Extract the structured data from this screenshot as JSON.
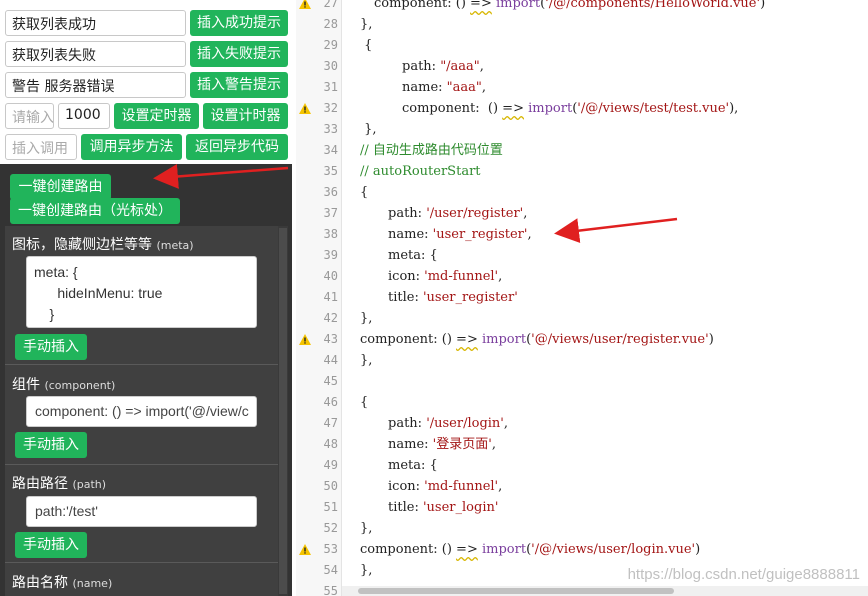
{
  "left": {
    "row1": {
      "input": "获取列表成功",
      "button": "插入成功提示"
    },
    "row2": {
      "input": "获取列表失败",
      "button": "插入失败提示"
    },
    "row3": {
      "input": "警告 服务器错误",
      "button": "插入警告提示"
    },
    "row4": {
      "input_placeholder": "请输入",
      "number_value": "1000",
      "btn_timer": "设置定时器",
      "btn_counter": "设置计时器"
    },
    "row5": {
      "input_placeholder": "插入调用",
      "btn_async_call": "调用异步方法",
      "btn_async_return": "返回异步代码"
    },
    "route": {
      "btn_create": "一键创建路由",
      "btn_create_cursor": "一键创建路由（光标处）",
      "sections": [
        {
          "title": "图标，隐藏侧边栏等等",
          "sub": "(meta)",
          "value": "meta: {\n      hideInMenu: true\n    }",
          "insert": "手动插入"
        },
        {
          "title": "组件",
          "sub": "(component)",
          "value": "component: () => import('@/view/c",
          "insert": "手动插入"
        },
        {
          "title": "路由路径",
          "sub": "(path)",
          "value": "path:'/test'",
          "insert": "手动插入"
        },
        {
          "title": "路由名称",
          "sub": "(name)"
        }
      ]
    }
  },
  "editor": {
    "lines": [
      {
        "n": "27",
        "warn": true
      },
      {
        "n": "28",
        "text": "},",
        "indent": 0
      },
      {
        "n": "29",
        "text": " {",
        "indent": 0
      },
      {
        "n": "30",
        "text": "path: \"/aaa\",",
        "indent": 3
      },
      {
        "n": "31",
        "text": "name: \"aaa\",",
        "indent": 3
      },
      {
        "n": "32",
        "text": "component:  () => import('/@/views/test/test.vue'),",
        "indent": 3,
        "warn": true
      },
      {
        "n": "33",
        "text": " },",
        "indent": 0
      },
      {
        "n": "34",
        "text": "// 自动生成路由代码位置",
        "indent": 0,
        "comment": true
      },
      {
        "n": "35",
        "text": "// autoRouterStart",
        "indent": 0,
        "comment": true
      },
      {
        "n": "36",
        "text": "{",
        "indent": 0
      },
      {
        "n": "37",
        "text": "path: '/user/register',",
        "indent": 2
      },
      {
        "n": "38",
        "text": "name: 'user_register',",
        "indent": 2
      },
      {
        "n": "39",
        "text": "meta: {",
        "indent": 2
      },
      {
        "n": "40",
        "text": "icon: 'md-funnel',",
        "indent": 2
      },
      {
        "n": "41",
        "text": "title: 'user_register'",
        "indent": 2
      },
      {
        "n": "42",
        "text": "},",
        "indent": 0
      },
      {
        "n": "43",
        "text": "component: () => import('@/views/user/register.vue')",
        "indent": 0,
        "warn": true
      },
      {
        "n": "44",
        "text": "},",
        "indent": 0
      },
      {
        "n": "45",
        "text": "",
        "indent": 0
      },
      {
        "n": "46",
        "text": "{",
        "indent": 0
      },
      {
        "n": "47",
        "text": "path: '/user/login',",
        "indent": 2
      },
      {
        "n": "48",
        "text": "name: '登录页面',",
        "indent": 2
      },
      {
        "n": "49",
        "text": "meta: {",
        "indent": 2
      },
      {
        "n": "50",
        "text": "icon: 'md-funnel',",
        "indent": 2
      },
      {
        "n": "51",
        "text": "title: 'user_login'",
        "indent": 2
      },
      {
        "n": "52",
        "text": "},",
        "indent": 0
      },
      {
        "n": "53",
        "text": "component: () => import('/@/views/user/login.vue')",
        "indent": 0,
        "warn": true
      },
      {
        "n": "54",
        "text": "},",
        "indent": 0
      },
      {
        "n": "55",
        "text": "",
        "indent": 0
      }
    ],
    "watermark": "https://blog.csdn.net/guige8888811"
  },
  "colors": {
    "green": "#21b45b",
    "dark_panel": "#333333",
    "arrow": "#e02020",
    "string": "#a31515",
    "keyword": "#7a3e9d",
    "comment": "#2e8b2e"
  }
}
